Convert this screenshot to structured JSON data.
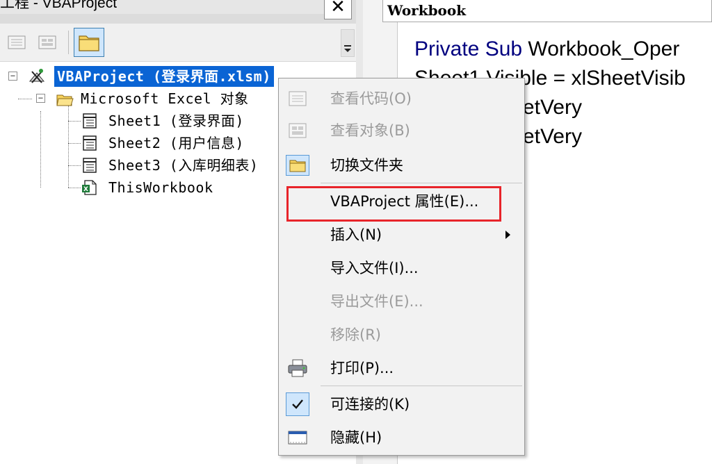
{
  "project_window": {
    "title": "工程 - VBAProject",
    "close_glyph": "✕"
  },
  "tree": {
    "root": {
      "label": "VBAProject (登录界面.xlsm)"
    },
    "excel_objects": {
      "label": "Microsoft Excel 对象"
    },
    "items": [
      {
        "label": "Sheet1 (登录界面)",
        "icon": "worksheet-icon"
      },
      {
        "label": "Sheet2 (用户信息)",
        "icon": "worksheet-icon"
      },
      {
        "label": "Sheet3 (入库明细表)",
        "icon": "worksheet-icon"
      },
      {
        "label": "ThisWorkbook",
        "icon": "workbook-icon"
      }
    ]
  },
  "code_window": {
    "object_dropdown": "Workbook",
    "lines": [
      {
        "keyword": "Private Sub ",
        "text": "Workbook_Oper"
      },
      {
        "keyword": "",
        "text": "Sheet1.Visible = xlSheetVisib"
      },
      {
        "keyword": "",
        "text": "ible = xlSheetVery"
      },
      {
        "keyword": "",
        "text": "ible = xlSheetVery"
      }
    ]
  },
  "context_menu": {
    "items": [
      {
        "label": "查看代码(O)",
        "icon": "view-code-icon",
        "disabled": true
      },
      {
        "label": "查看对象(B)",
        "icon": "view-object-icon",
        "disabled": true
      },
      {
        "label": "切换文件夹",
        "icon": "folder-icon",
        "disabled": false
      },
      {
        "label": "VBAProject 属性(E)...",
        "icon": "",
        "disabled": false
      },
      {
        "label": "插入(N)",
        "icon": "",
        "disabled": false,
        "submenu": true
      },
      {
        "label": "导入文件(I)...",
        "icon": "",
        "disabled": false
      },
      {
        "label": "导出文件(E)...",
        "icon": "",
        "disabled": true
      },
      {
        "label": "移除(R)",
        "icon": "",
        "disabled": true
      },
      {
        "label": "打印(P)...",
        "icon": "printer-icon",
        "disabled": false
      },
      {
        "label": "可连接的(K)",
        "icon": "checkmark-icon",
        "disabled": false,
        "checked": true
      },
      {
        "label": "隐藏(H)",
        "icon": "hide-window-icon",
        "disabled": false
      }
    ],
    "highlight_color": "#e8242a"
  },
  "colors": {
    "selection": "#0a64d4",
    "keyword": "#00007f",
    "disabled_text": "#9b9b9b"
  }
}
